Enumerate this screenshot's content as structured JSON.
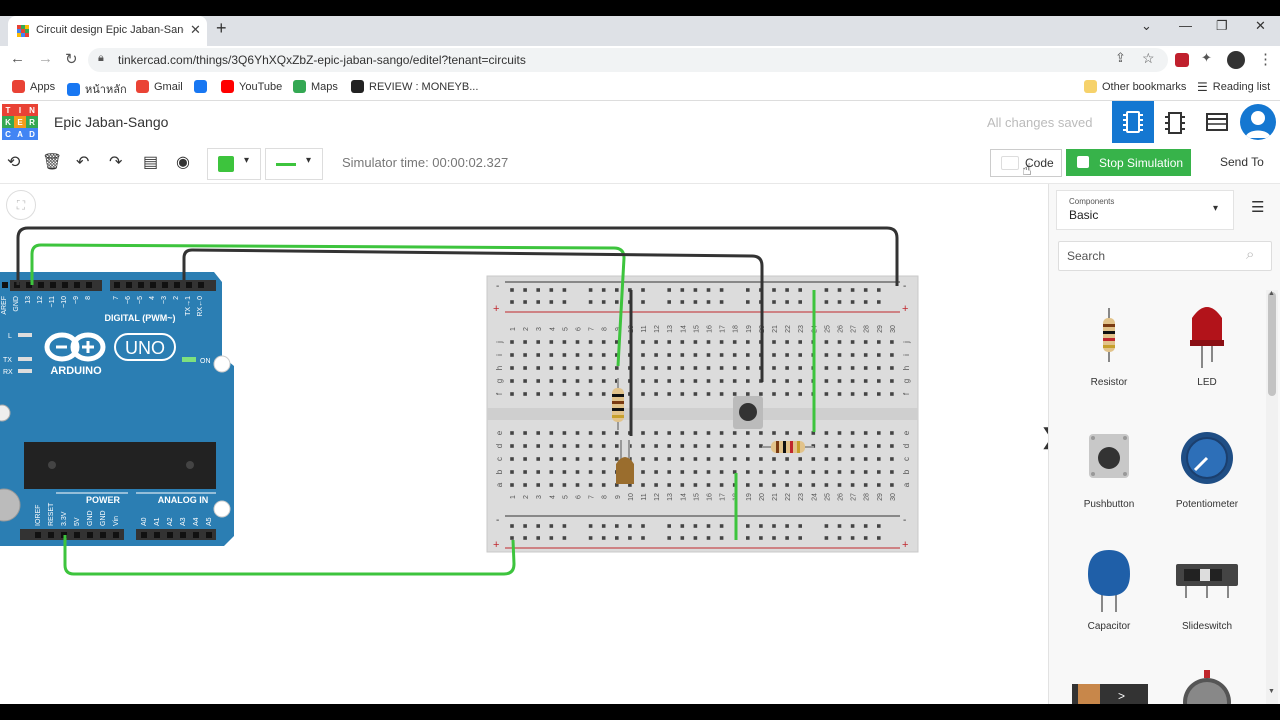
{
  "browser": {
    "tab_title": "Circuit design Epic Jaban-Sango",
    "url": "tinkercad.com/things/3Q6YhXQxZbZ-epic-jaban-sango/editel?tenant=circuits",
    "bookmarks": [
      {
        "label": "Apps",
        "color": "#e94235"
      },
      {
        "label": "หน้าหลัก",
        "color": "#1877f2"
      },
      {
        "label": "Gmail",
        "color": "#ea4335"
      },
      {
        "label": "",
        "color": "#1877f2"
      },
      {
        "label": "YouTube",
        "color": "#ff0000"
      },
      {
        "label": "Maps",
        "color": "#34a853"
      },
      {
        "label": "REVIEW : MONEYB...",
        "color": "#222222"
      }
    ],
    "other_bookmarks": "Other bookmarks",
    "reading_list": "Reading list"
  },
  "app": {
    "logo_letters": [
      "T",
      "I",
      "N",
      "K",
      "E",
      "R",
      "C",
      "A",
      "D"
    ],
    "design_name": "Epic Jaban-Sango",
    "save_status": "All changes saved"
  },
  "toolbar": {
    "simulator_time": "Simulator time: 00:00:02.327",
    "code_label": "Code",
    "stop_label": "Stop Simulation",
    "send_label": "Send To",
    "wire_color": "#3dc43d"
  },
  "panel": {
    "components_small": "Components",
    "components_value": "Basic",
    "search_placeholder": "Search",
    "items": [
      {
        "label": "Resistor",
        "icon": "resistor-icon"
      },
      {
        "label": "LED",
        "icon": "led-icon"
      },
      {
        "label": "Pushbutton",
        "icon": "pushbutton-icon"
      },
      {
        "label": "Potentiometer",
        "icon": "potentiometer-icon"
      },
      {
        "label": "Capacitor",
        "icon": "capacitor-icon"
      },
      {
        "label": "Slideswitch",
        "icon": "slideswitch-icon"
      }
    ]
  },
  "arduino": {
    "digital_label": "DIGITAL (PWM~)",
    "uno_label": "UNO",
    "brand": "ARDUINO",
    "on_label": "ON",
    "power_label": "POWER",
    "analog_label": "ANALOG IN",
    "top_pins": [
      "AREF",
      "GND",
      "13",
      "12",
      "~11",
      "~10",
      "~9",
      "8",
      "7",
      "~6",
      "~5",
      "4",
      "~3",
      "2",
      "TX→1",
      "RX←0"
    ],
    "bottom_pins": [
      "IOREF",
      "RESET",
      "3.3V",
      "5V",
      "GND",
      "GND",
      "Vin",
      "A0",
      "A1",
      "A2",
      "A3",
      "A4",
      "A5"
    ],
    "side_labels": [
      "L",
      "TX",
      "RX"
    ]
  },
  "breadboard": {
    "row_letters_top": [
      "j",
      "i",
      "h",
      "g",
      "f"
    ],
    "row_letters_bottom": [
      "e",
      "d",
      "c",
      "b",
      "a"
    ],
    "column_numbers": [
      "1",
      "2",
      "3",
      "4",
      "5",
      "6",
      "7",
      "8",
      "9",
      "10",
      "11",
      "12",
      "13",
      "14",
      "15",
      "16",
      "17",
      "18",
      "19",
      "20",
      "21",
      "22",
      "23",
      "24",
      "25",
      "26",
      "27",
      "28",
      "29",
      "30"
    ]
  }
}
